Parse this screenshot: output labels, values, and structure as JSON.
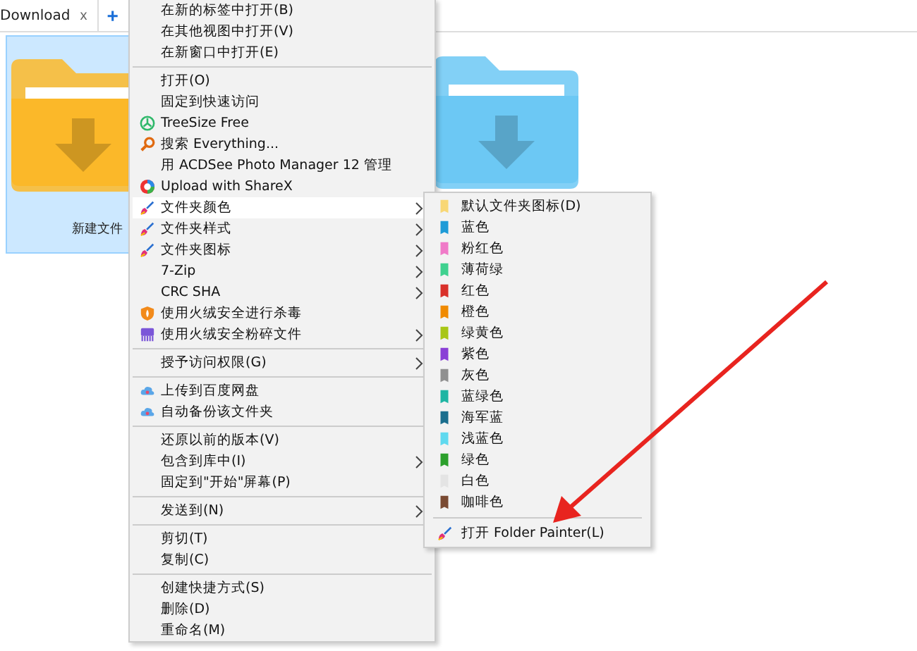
{
  "tab": {
    "label": "Download",
    "close": "x",
    "new_tab": "+"
  },
  "folders": [
    {
      "label": "新建文件",
      "color": "#fbb829",
      "selected": true
    },
    {
      "color": "#6cc8f4",
      "selected": false
    }
  ],
  "context_menu": {
    "groups": [
      [
        {
          "label": "在新的标签中打开(B)"
        },
        {
          "label": "在其他视图中打开(V)"
        },
        {
          "label": "在新窗口中打开(E)"
        }
      ],
      [
        {
          "label": "打开(O)"
        },
        {
          "label": "固定到快速访问"
        },
        {
          "label": "TreeSize Free",
          "kind": "treesize"
        },
        {
          "label": "搜索 Everything...",
          "kind": "everything"
        },
        {
          "label": "用 ACDSee Photo Manager 12 管理"
        },
        {
          "label": "Upload with ShareX",
          "kind": "sharex"
        },
        {
          "label": "文件夹颜色",
          "kind": "painter",
          "submenu": true,
          "selected": true
        },
        {
          "label": "文件夹样式",
          "kind": "painter",
          "submenu": true,
          "selected": false
        },
        {
          "label": "文件夹图标",
          "kind": "painter",
          "submenu": true,
          "selected": false
        },
        {
          "label": "7-Zip",
          "submenu": true
        },
        {
          "label": "CRC SHA",
          "submenu": true
        },
        {
          "label": "使用火绒安全进行杀毒",
          "kind": "huorong"
        },
        {
          "label": "使用火绒安全粉碎文件",
          "kind": "shredder",
          "submenu": true
        }
      ],
      [
        {
          "label": "授予访问权限(G)",
          "submenu": true
        }
      ],
      [
        {
          "label": "上传到百度网盘",
          "kind": "baidu"
        },
        {
          "label": "自动备份该文件夹",
          "kind": "baidu"
        }
      ],
      [
        {
          "label": "还原以前的版本(V)"
        },
        {
          "label": "包含到库中(I)",
          "submenu": true
        },
        {
          "label": "固定到\"开始\"屏幕(P)"
        }
      ],
      [
        {
          "label": "发送到(N)",
          "submenu": true
        }
      ],
      [
        {
          "label": "剪切(T)"
        },
        {
          "label": "复制(C)"
        }
      ],
      [
        {
          "label": "创建快捷方式(S)"
        },
        {
          "label": "删除(D)"
        },
        {
          "label": "重命名(M)"
        }
      ]
    ]
  },
  "color_submenu": {
    "items": [
      {
        "label": "默认文件夹图标(D)",
        "color": "#f8d775"
      },
      {
        "label": "蓝色",
        "color": "#1e9bd7"
      },
      {
        "label": "粉红色",
        "color": "#f07ac8"
      },
      {
        "label": "薄荷绿",
        "color": "#3fd18f"
      },
      {
        "label": "红色",
        "color": "#d9302a"
      },
      {
        "label": "橙色",
        "color": "#f08a00"
      },
      {
        "label": "绿黄色",
        "color": "#a8c615"
      },
      {
        "label": "紫色",
        "color": "#8a3fd6"
      },
      {
        "label": "灰色",
        "color": "#909090"
      },
      {
        "label": "蓝绿色",
        "color": "#1fb5a3"
      },
      {
        "label": "海军蓝",
        "color": "#1a6e8e"
      },
      {
        "label": "浅蓝色",
        "color": "#5fd9ef"
      },
      {
        "label": "绿色",
        "color": "#2ca02c"
      },
      {
        "label": "白色",
        "color": "#e4e4e4"
      },
      {
        "label": "咖啡色",
        "color": "#7a4a32"
      }
    ],
    "footer": {
      "label": "打开 Folder Painter(L)",
      "kind": "painter"
    }
  }
}
